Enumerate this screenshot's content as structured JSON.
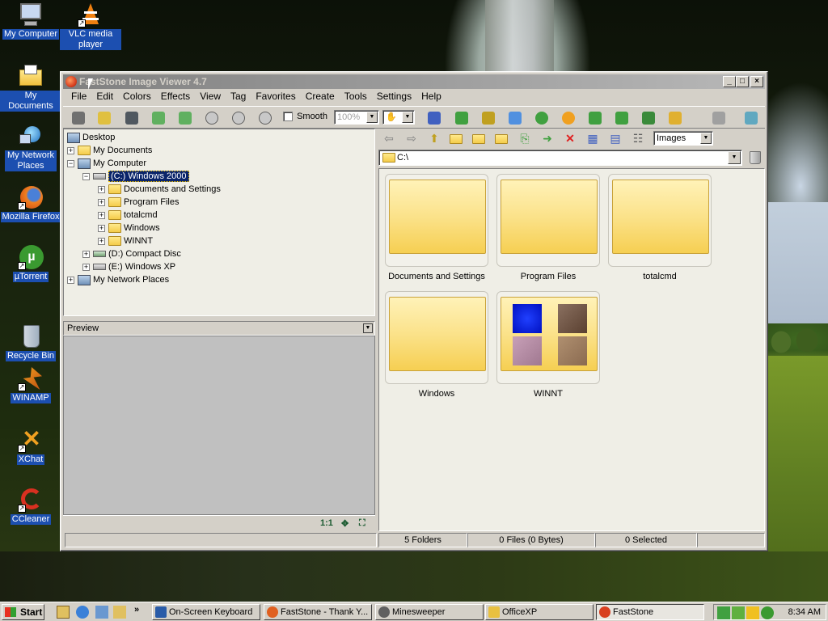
{
  "desktop": {
    "icons": [
      {
        "label": "My Computer",
        "icon": "my-computer-icon"
      },
      {
        "label": "VLC media player",
        "icon": "vlc-icon"
      },
      {
        "label": "My Documents",
        "icon": "my-documents-icon"
      },
      {
        "label": "My Network Places",
        "icon": "network-places-icon"
      },
      {
        "label": "Mozilla Firefox",
        "icon": "firefox-icon"
      },
      {
        "label": "µTorrent",
        "icon": "utorrent-icon"
      },
      {
        "label": "Recycle Bin",
        "icon": "recycle-bin-icon"
      },
      {
        "label": "WINAMP",
        "icon": "winamp-icon"
      },
      {
        "label": "XChat",
        "icon": "xchat-icon"
      },
      {
        "label": "CCleaner",
        "icon": "ccleaner-icon"
      }
    ]
  },
  "window": {
    "title": "FastStone Image Viewer 4.7",
    "buttons": {
      "minimize": "_",
      "maximize": "□",
      "close": "×"
    }
  },
  "menu": [
    "File",
    "Edit",
    "Colors",
    "Effects",
    "View",
    "Tag",
    "Favorites",
    "Create",
    "Tools",
    "Settings",
    "Help"
  ],
  "toolbar": {
    "smooth_label": "Smooth",
    "zoom_value": "100%"
  },
  "tree": {
    "desktop": "Desktop",
    "my_documents": "My Documents",
    "my_computer": "My Computer",
    "drive_c": "(C:) Windows 2000",
    "children": [
      "Documents and Settings",
      "Program Files",
      "totalcmd",
      "Windows",
      "WINNT"
    ],
    "drive_d": "(D:) Compact Disc",
    "drive_e": "(E:) Windows XP",
    "network": "My Network Places"
  },
  "preview": {
    "label": "Preview",
    "ratio_label": "1:1"
  },
  "browser": {
    "filter_value": "Images",
    "path": "C:\\",
    "folders": [
      {
        "name": "Documents and Settings"
      },
      {
        "name": "Program Files"
      },
      {
        "name": "totalcmd"
      },
      {
        "name": "Windows"
      },
      {
        "name": "WINNT"
      }
    ]
  },
  "status": {
    "folders": "5 Folders",
    "files": "0 Files (0 Bytes)",
    "selected": "0 Selected"
  },
  "taskbar": {
    "start": "Start",
    "tasks": [
      {
        "label": "On-Screen Keyboard",
        "color": "#2a5ca8"
      },
      {
        "label": "FastStone - Thank Y...",
        "color": "#e06020"
      },
      {
        "label": "Minesweeper",
        "color": "#606060"
      },
      {
        "label": "OfficeXP",
        "color": "#e8c040"
      },
      {
        "label": "FastStone",
        "color": "#d84020"
      }
    ],
    "clock": "8:34 AM"
  }
}
